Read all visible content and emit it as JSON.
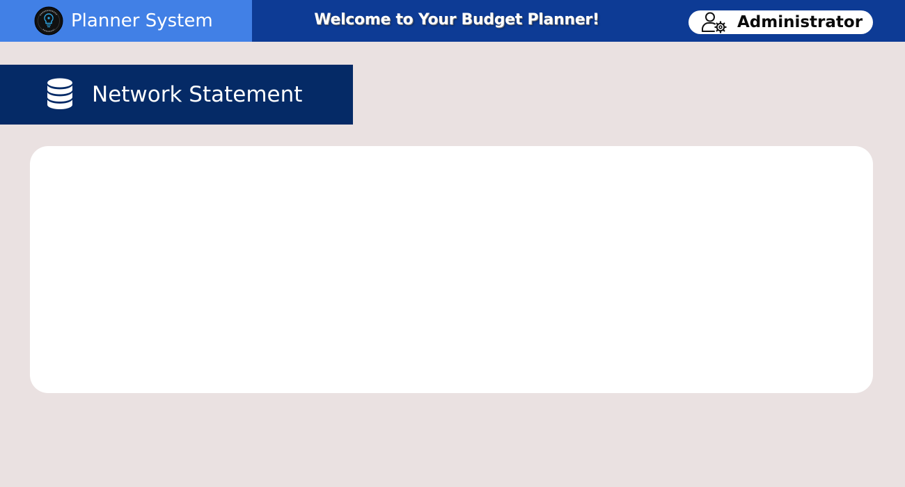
{
  "header": {
    "brand_title": "Planner System",
    "welcome_text": "Welcome to Your Budget Planner!",
    "user_label": "Administrator",
    "logo_icon": "budget-planner-logo",
    "user_icon": "user-settings-icon"
  },
  "section": {
    "title": "Network Statement",
    "icon": "database-icon"
  },
  "colors": {
    "page_background": "#eae1e1",
    "topbar": "#0d3b95",
    "brand_block": "#4180e6",
    "section_header": "#052a66",
    "card": "#ffffff"
  }
}
